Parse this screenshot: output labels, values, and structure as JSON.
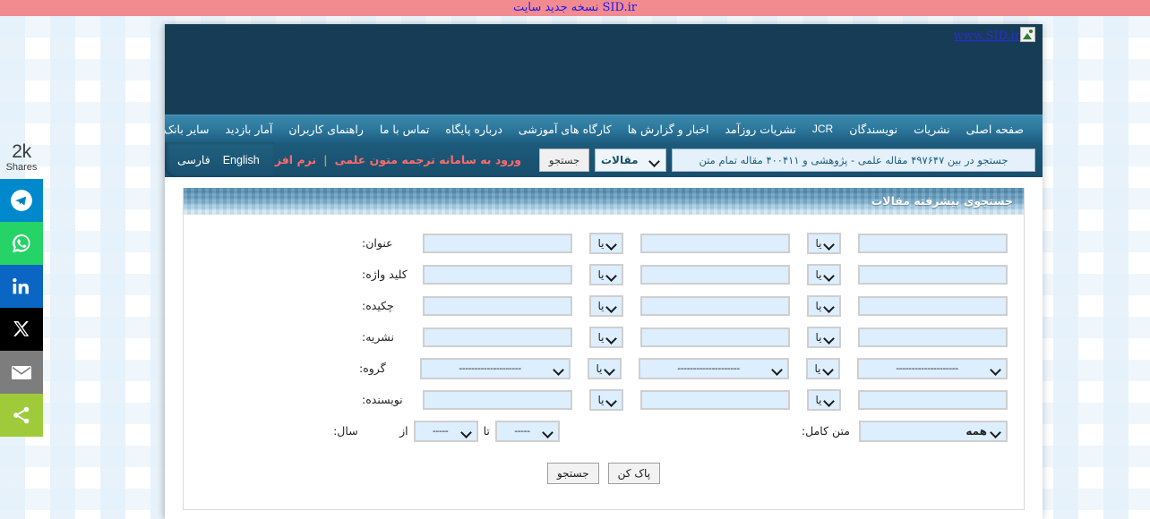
{
  "top_banner": {
    "text_rtl": "نسخه جدید سایت",
    "text_latin": "SID.ir"
  },
  "share_rail": {
    "count": "2k",
    "count_label": "Shares",
    "buttons": [
      {
        "name": "telegram-share-button"
      },
      {
        "name": "whatsapp-share-button"
      },
      {
        "name": "linkedin-share-button"
      },
      {
        "name": "x-share-button"
      },
      {
        "name": "email-share-button"
      },
      {
        "name": "more-share-button"
      }
    ]
  },
  "header": {
    "logo_text": "www.SID.ir"
  },
  "nav": {
    "items": [
      {
        "label": "صفحه اصلی"
      },
      {
        "label": "نشریات"
      },
      {
        "label": "نویسندگان"
      },
      {
        "label": "JCR",
        "latin": true
      },
      {
        "label": "نشریات روزآمد"
      },
      {
        "label": "اخبار و گزارش ها"
      },
      {
        "label": "کارگاه های آموزشی"
      },
      {
        "label": "درباره پایگاه"
      },
      {
        "label": "تماس با ما"
      },
      {
        "label": "راهنمای کاربران"
      },
      {
        "label": "آمار بازدید"
      },
      {
        "label": "سایر بانک های مرکز اطلاعات علمی"
      }
    ]
  },
  "search_strip": {
    "placeholder": "جستجو در بین ۴۹۷۶۴۷ مقاله علمی - پژوهشی و ۴۰۰۴۱۱ مقاله تمام متن",
    "type_label": "مقالات",
    "go_label": "جستجو",
    "promo_1": "ورود به سامانه ترجمه متون علمی",
    "promo_sep": "|",
    "promo_2": "نرم افزار اندروید",
    "lang_fa": "فارسی",
    "lang_en": "English"
  },
  "panel": {
    "title": "جستجوی پیشرفته مقالات",
    "or_label": "یا",
    "dash_long": "--------------------",
    "dash_short": "-----",
    "rows": [
      {
        "label": "عنوان:",
        "type": "text"
      },
      {
        "label": "کلید واژه:",
        "type": "text"
      },
      {
        "label": "چکیده:",
        "type": "text"
      },
      {
        "label": "نشریه:",
        "type": "text"
      },
      {
        "label": "گروه:",
        "type": "select"
      },
      {
        "label": "نویسنده:",
        "type": "text"
      }
    ],
    "year_row": {
      "label": "سال:",
      "from_label": "از",
      "to_label": "تا",
      "from_value": "-----",
      "to_value": "-----"
    },
    "fulltext": {
      "label": "متن کامل:",
      "value": "همه"
    },
    "buttons": {
      "search": "جستجو",
      "clear": "پاک کن"
    }
  }
}
